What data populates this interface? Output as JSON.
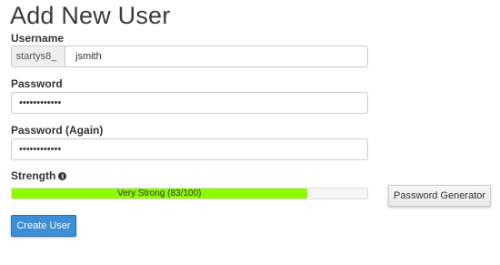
{
  "page": {
    "title": "Add New User"
  },
  "form": {
    "username": {
      "label": "Username",
      "prefix": "startys8_",
      "value": "jsmith"
    },
    "password": {
      "label": "Password",
      "value": "••••••••••••"
    },
    "password_again": {
      "label": "Password (Again)",
      "value": "••••••••••••"
    },
    "strength": {
      "label": "Strength",
      "info_icon": "info-icon",
      "text": "Very Strong (83/100)",
      "score": 83,
      "max": 100,
      "bar_color": "#8cfa00"
    }
  },
  "buttons": {
    "password_generator": "Password Generator",
    "create_user": "Create User"
  },
  "colors": {
    "primary_button": "#3c8ed6",
    "strength_fill": "#8cfa00"
  }
}
